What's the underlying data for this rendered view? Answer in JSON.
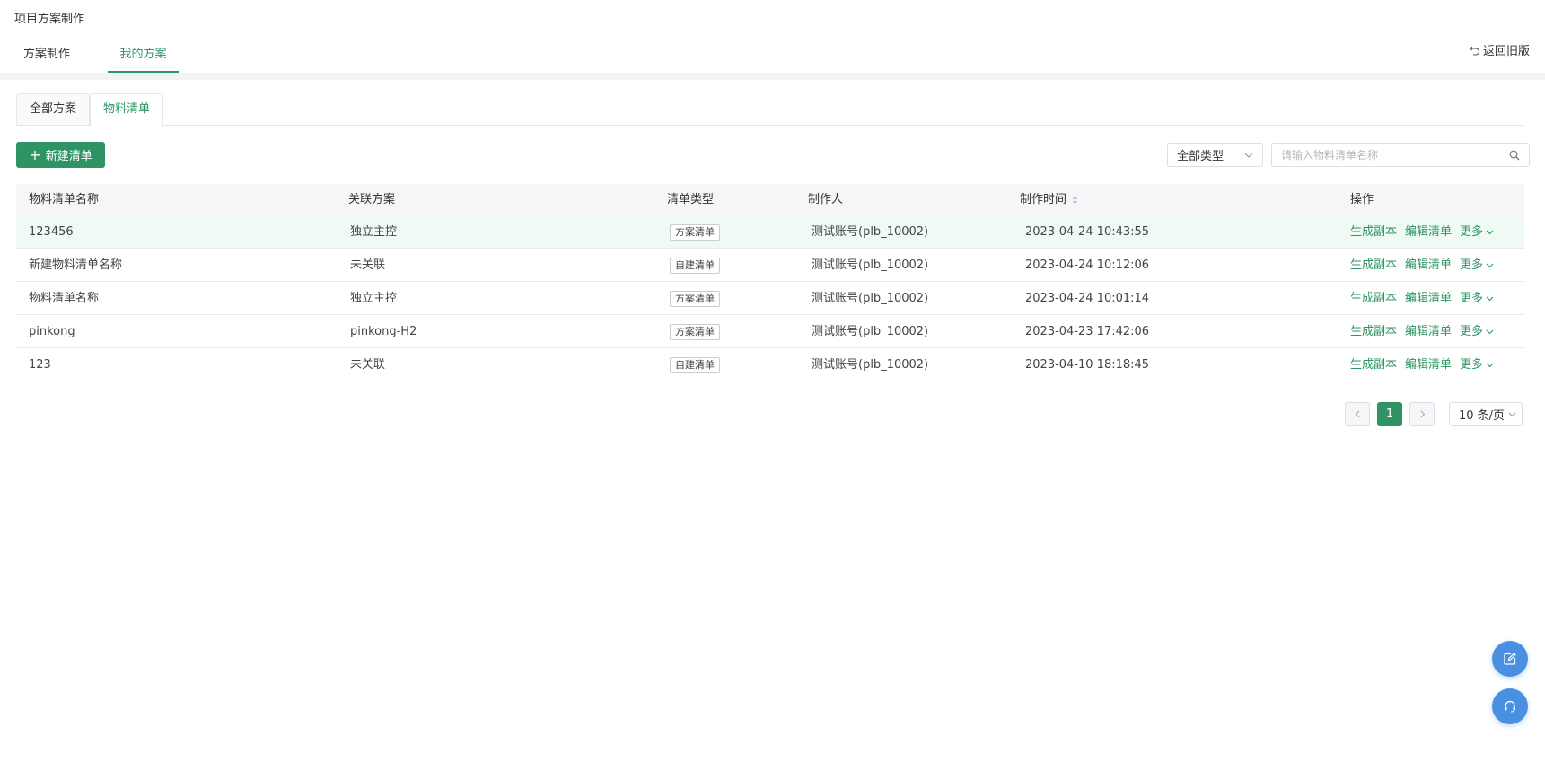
{
  "header": {
    "title": "项目方案制作",
    "tabs": [
      {
        "label": "方案制作"
      },
      {
        "label": "我的方案"
      }
    ],
    "return_label": "返回旧版"
  },
  "sub_tabs": [
    {
      "label": "全部方案"
    },
    {
      "label": "物料清单"
    }
  ],
  "toolbar": {
    "new_label": "新建清单",
    "type_select_value": "全部类型",
    "search_placeholder": "请输入物料清单名称"
  },
  "table": {
    "columns": [
      "物料清单名称",
      "关联方案",
      "清单类型",
      "制作人",
      "制作时间",
      "操作"
    ],
    "rows": [
      {
        "name": "123456",
        "plan": "独立主控",
        "type": "方案清单",
        "maker": "测试账号(plb_10002)",
        "time": "2023-04-24 10:43:55"
      },
      {
        "name": "新建物料清单名称",
        "plan": "未关联",
        "type": "自建清单",
        "maker": "测试账号(plb_10002)",
        "time": "2023-04-24 10:12:06"
      },
      {
        "name": "物料清单名称",
        "plan": "独立主控",
        "type": "方案清单",
        "maker": "测试账号(plb_10002)",
        "time": "2023-04-24 10:01:14"
      },
      {
        "name": "pinkong",
        "plan": "pinkong-H2",
        "type": "方案清单",
        "maker": "测试账号(plb_10002)",
        "time": "2023-04-23 17:42:06"
      },
      {
        "name": "123",
        "plan": "未关联",
        "type": "自建清单",
        "maker": "测试账号(plb_10002)",
        "time": "2023-04-10 18:18:45"
      }
    ],
    "actions": {
      "copy": "生成副本",
      "edit": "编辑清单",
      "more": "更多"
    }
  },
  "pagination": {
    "current_page": "1",
    "page_size": "10 条/页"
  },
  "colors": {
    "accent": "#2e9463",
    "float_button": "#4a90e2",
    "row_highlight": "#f0faf5"
  },
  "icons": [
    "return-icon",
    "plus-icon",
    "chevron-down-icon",
    "search-icon",
    "sort-icon",
    "chevron-left-icon",
    "chevron-right-icon",
    "edit-icon",
    "headset-icon"
  ]
}
